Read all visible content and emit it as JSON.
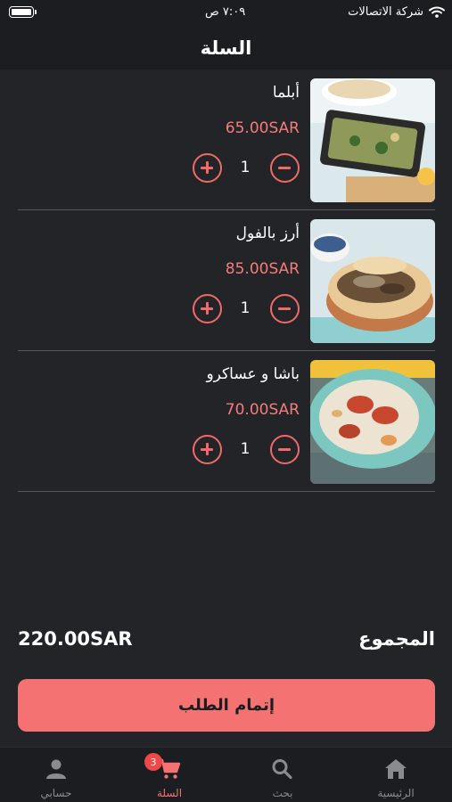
{
  "status": {
    "carrier": "شركة الاتصالات",
    "time": "٧:٠٩ ص"
  },
  "header": {
    "title": "السلة"
  },
  "items": [
    {
      "name": "أبلما",
      "price": "65.00SAR",
      "quantity": "1",
      "image": "baked-dish-photo"
    },
    {
      "name": "أرز بالفول",
      "price": "85.00SAR",
      "quantity": "1",
      "image": "rice-beans-photo"
    },
    {
      "name": "باشا و عساكرو",
      "price": "70.00SAR",
      "quantity": "1",
      "image": "soup-bowl-photo"
    }
  ],
  "totals": {
    "label": "المجموع",
    "amount": "220.00SAR"
  },
  "checkout": {
    "label": "إتمام الطلب"
  },
  "tabbar": {
    "cart_badge": "3",
    "tabs": [
      {
        "label": "حسابي",
        "icon": "person-icon"
      },
      {
        "label": "السلة",
        "icon": "cart-icon",
        "active": true
      },
      {
        "label": "بحث",
        "icon": "search-icon"
      },
      {
        "label": "الرئيسية",
        "icon": "home-icon"
      }
    ]
  },
  "colors": {
    "accent": "#f47272",
    "background": "#232427",
    "bar": "#1c1d20"
  }
}
